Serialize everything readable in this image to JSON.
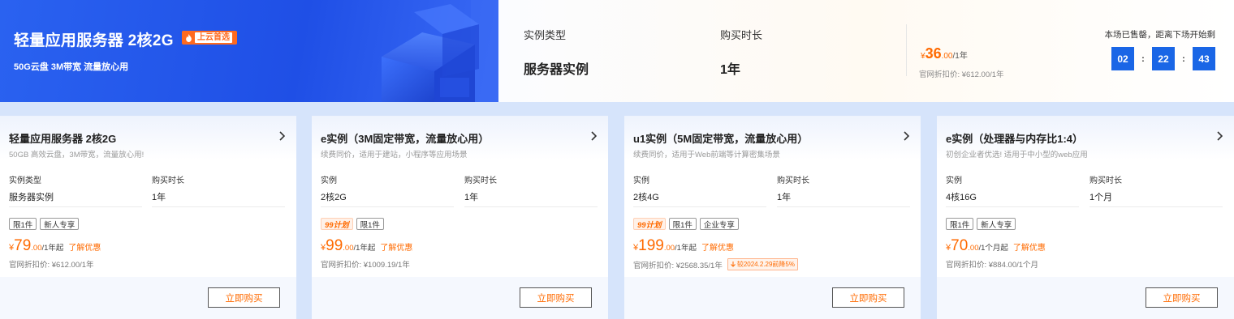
{
  "hero": {
    "title": "轻量应用服务器 2核2G",
    "badge": "上云首选",
    "subtitle": "50G云盘 3M带宽 流量放心用"
  },
  "top_panel": {
    "type_label": "实例类型",
    "type_value": "服务器实例",
    "duration_label": "购买时长",
    "duration_value": "1年",
    "price_currency": "¥",
    "price_int": "36",
    "price_dec": ".00",
    "price_unit": "/1年",
    "orig_price": "官网折扣价: ¥612.00/1年",
    "countdown_label": "本场已售罄，距离下场开始剩",
    "countdown": [
      "02",
      "22",
      "43"
    ],
    "sep": ":"
  },
  "cards": [
    {
      "title": "轻量应用服务器 2核2G",
      "desc": "50GB 高效云盘，3M带宽，流量放心用!",
      "spec1_label": "实例类型",
      "spec1_value": "服务器实例",
      "spec2_label": "购买时长",
      "spec2_value": "1年",
      "tags": [
        "限1件",
        "新人专享"
      ],
      "price_cur": "¥",
      "price_int": "79",
      "price_dec": ".00",
      "price_unit": "/1年起",
      "link": "了解优惠",
      "orig": "官网折扣价: ¥612.00/1年",
      "buy": "立即购买"
    },
    {
      "title": "e实例（3M固定带宽，流量放心用）",
      "desc": "续费同价，适用于建站，小程序等应用场景",
      "spec1_label": "实例",
      "spec1_value": "2核2G",
      "spec2_label": "购买时长",
      "spec2_value": "1年",
      "hot_tag": "99计划",
      "tags": [
        "限1件"
      ],
      "price_cur": "¥",
      "price_int": "99",
      "price_dec": ".00",
      "price_unit": "/1年起",
      "link": "了解优惠",
      "orig": "官网折扣价: ¥1009.19/1年",
      "buy": "立即购买"
    },
    {
      "title": "u1实例（5M固定带宽，流量放心用）",
      "desc": "续费同价，适用于Web前端等计算密集场景",
      "spec1_label": "实例",
      "spec1_value": "2核4G",
      "spec2_label": "购买时长",
      "spec2_value": "1年",
      "hot_tag": "99计划",
      "tags": [
        "限1件",
        "企业专享"
      ],
      "price_cur": "¥",
      "price_int": "199",
      "price_dec": ".00",
      "price_unit": "/1年起",
      "link": "了解优惠",
      "orig": "官网折扣价: ¥2568.35/1年",
      "note": "较2024.2.29前降5%",
      "buy": "立即购买"
    },
    {
      "title": "e实例（处理器与内存比1:4）",
      "desc": "初创企业者优选! 适用于中小型的web应用",
      "spec1_label": "实例",
      "spec1_value": "4核16G",
      "spec2_label": "购买时长",
      "spec2_value": "1个月",
      "tags": [
        "限1件",
        "新人专享"
      ],
      "price_cur": "¥",
      "price_int": "70",
      "price_dec": ".00",
      "price_unit": "/1个月起",
      "link": "了解优惠",
      "orig": "官网折扣价: ¥884.00/1个月",
      "buy": "立即购买"
    }
  ],
  "colors": {
    "brand_blue": "#1f4fe6",
    "accent_orange": "#ff6a00",
    "timer_blue": "#1a66e6"
  },
  "icons": {
    "badge": "flame-icon",
    "card_arrow": "chevron-right-icon",
    "note": "down-arrow-icon",
    "hero_art": "server-illustration"
  }
}
